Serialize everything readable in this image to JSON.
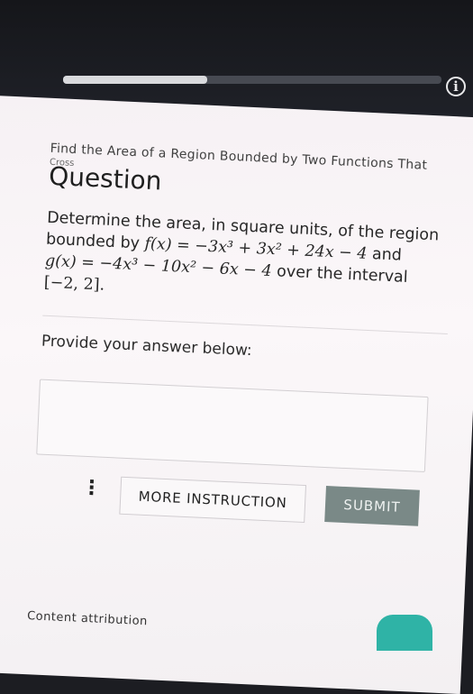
{
  "header": {
    "progress_fraction": 0.38
  },
  "info_button": {
    "glyph": "i",
    "icon": "info-icon"
  },
  "question": {
    "topic": "Find the Area of a Region Bounded by Two Functions That",
    "topic_overflow": "Cross",
    "title": "Question",
    "line1": "Determine the area, in square units, of the region",
    "line2_prefix": "bounded by ",
    "f_expr": "f(x) = −3x³ + 3x² + 24x − 4",
    "and_word": " and",
    "g_expr": "g(x) = −4x³ − 10x² − 6x − 4",
    "over_text": " over the interval",
    "interval": "[−2, 2]."
  },
  "answer": {
    "prompt": "Provide your answer below:"
  },
  "actions": {
    "menu_glyph": "⋮",
    "more_label": "MORE INSTRUCTION",
    "submit_label": "SUBMIT"
  },
  "footer": {
    "attribution": "Content attribution"
  },
  "colors": {
    "submit_bg": "#7a8987",
    "accent_teal": "#2fb3a6",
    "progress_fill": "#d9dadd"
  }
}
